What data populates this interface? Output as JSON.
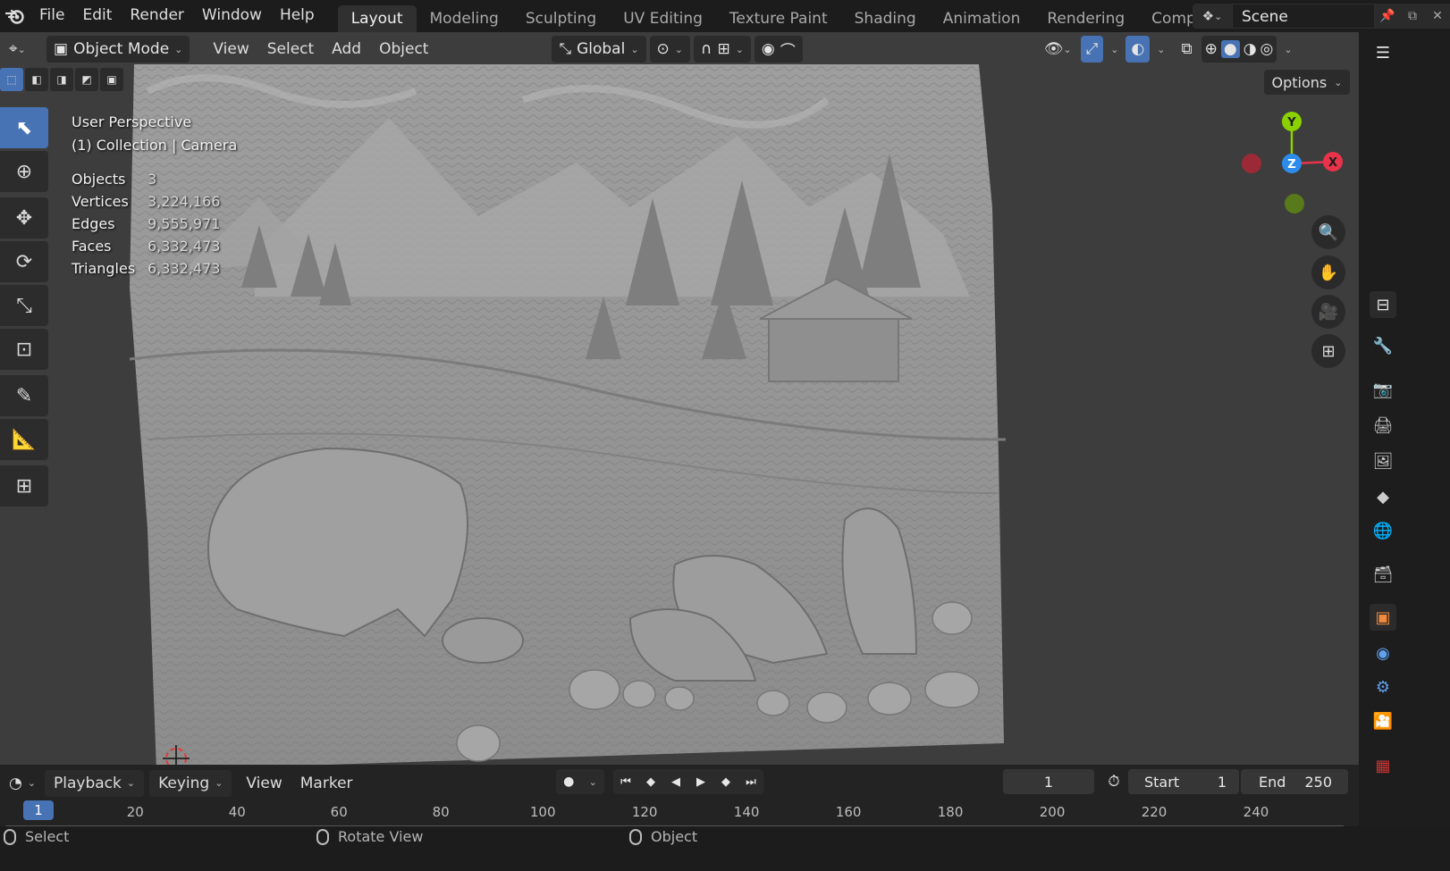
{
  "menu": {
    "items": [
      "File",
      "Edit",
      "Render",
      "Window",
      "Help"
    ]
  },
  "workspaces": {
    "tabs": [
      "Layout",
      "Modeling",
      "Sculpting",
      "UV Editing",
      "Texture Paint",
      "Shading",
      "Animation",
      "Rendering",
      "Compositin"
    ]
  },
  "scene": {
    "name": "Scene"
  },
  "viewport_header": {
    "mode": "Object Mode",
    "menus": [
      "View",
      "Select",
      "Add",
      "Object"
    ],
    "transform_orientation": "Global"
  },
  "overlay": {
    "perspective": "User Perspective",
    "collection": "(1) Collection | Camera"
  },
  "stats": [
    {
      "label": "Objects",
      "value": "3"
    },
    {
      "label": "Vertices",
      "value": "3,224,166"
    },
    {
      "label": "Edges",
      "value": "9,555,971"
    },
    {
      "label": "Faces",
      "value": "6,332,473"
    },
    {
      "label": "Triangles",
      "value": "6,332,473"
    }
  ],
  "options": {
    "label": "Options"
  },
  "gizmo": {
    "y": "Y",
    "z": "Z",
    "x": "X"
  },
  "timeline": {
    "menus": [
      "Playback",
      "Keying",
      "View",
      "Marker"
    ],
    "current_frame": "1",
    "start_label": "Start",
    "start_value": "1",
    "end_label": "End",
    "end_value": "250",
    "ruler_marks": [
      "1",
      "20",
      "40",
      "60",
      "80",
      "100",
      "120",
      "140",
      "160",
      "180",
      "200",
      "220",
      "240"
    ]
  },
  "statusbar": {
    "select": "Select",
    "rotate": "Rotate View",
    "object": "Object"
  },
  "colors": {
    "accent": "#4772b3",
    "axis_x": "#e8334a",
    "axis_y": "#8bd100",
    "axis_z": "#2d8ceb",
    "viewport_bg": "#3d3d3d"
  }
}
